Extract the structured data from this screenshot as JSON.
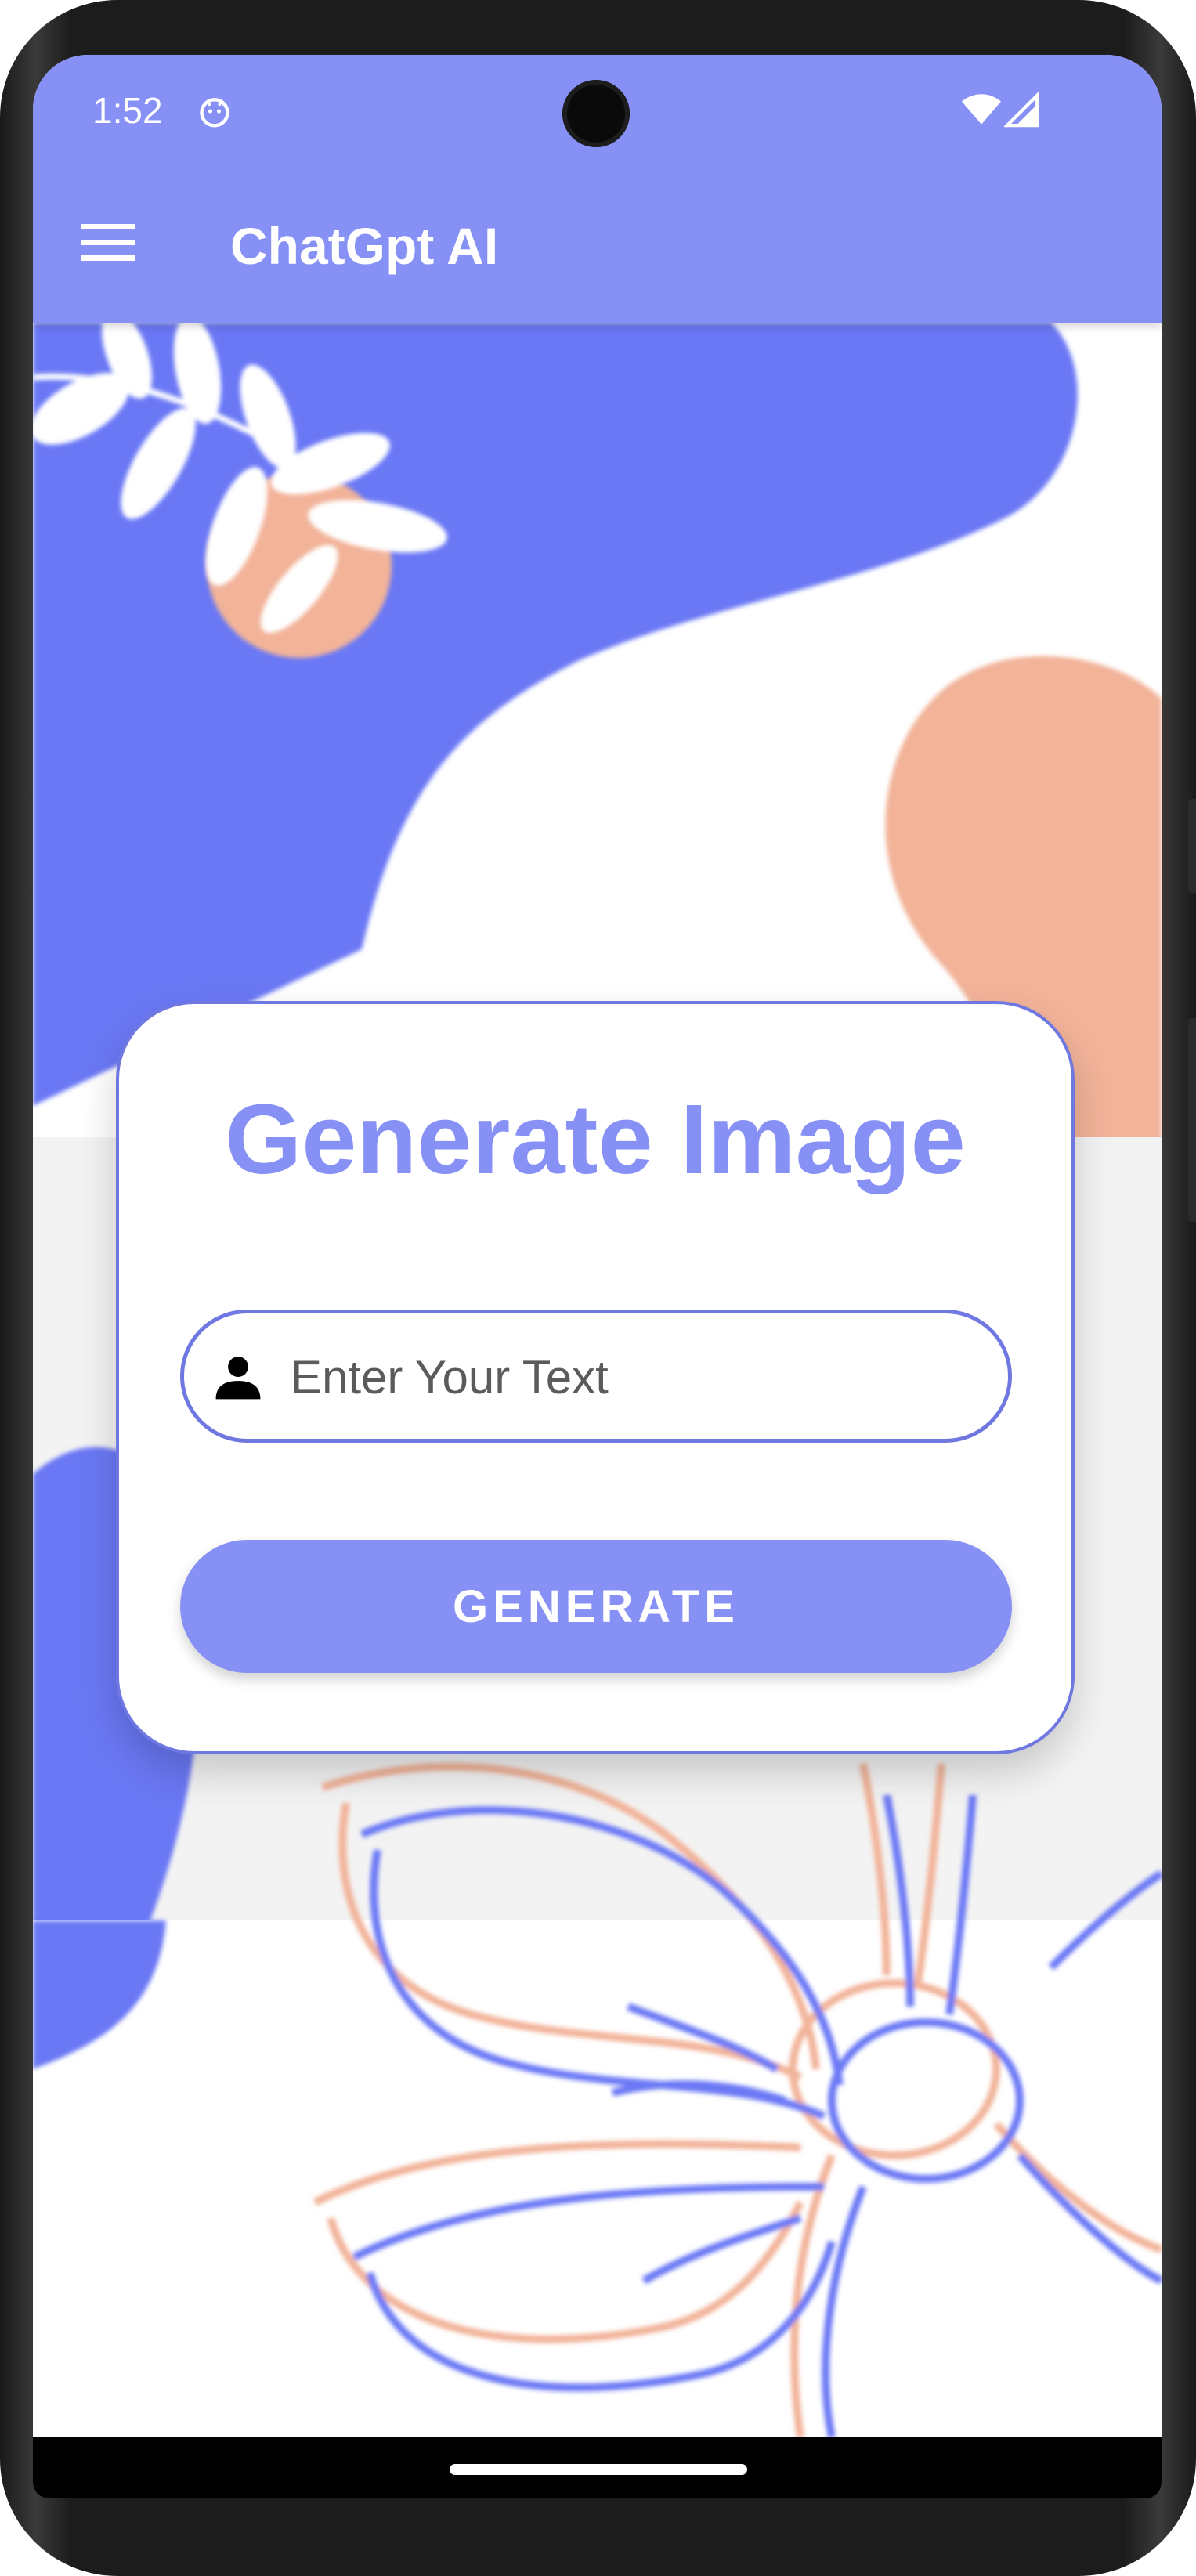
{
  "status_bar": {
    "time": "1:52",
    "icons": [
      "android-app-icon",
      "wifi-icon",
      "signal-icon"
    ]
  },
  "app_bar": {
    "title": "ChatGpt AI",
    "menu_icon": "hamburger-menu-icon",
    "color": "#8790f5"
  },
  "card": {
    "title": "Generate Image",
    "input": {
      "placeholder": "Enter Your Text",
      "value": "",
      "icon": "person-icon"
    },
    "button_label": "GENERATE"
  },
  "colors": {
    "primary": "#8790f5",
    "border": "#6f78e0",
    "blob_blue": "#6b78f5",
    "blob_peach": "#f2b399"
  }
}
